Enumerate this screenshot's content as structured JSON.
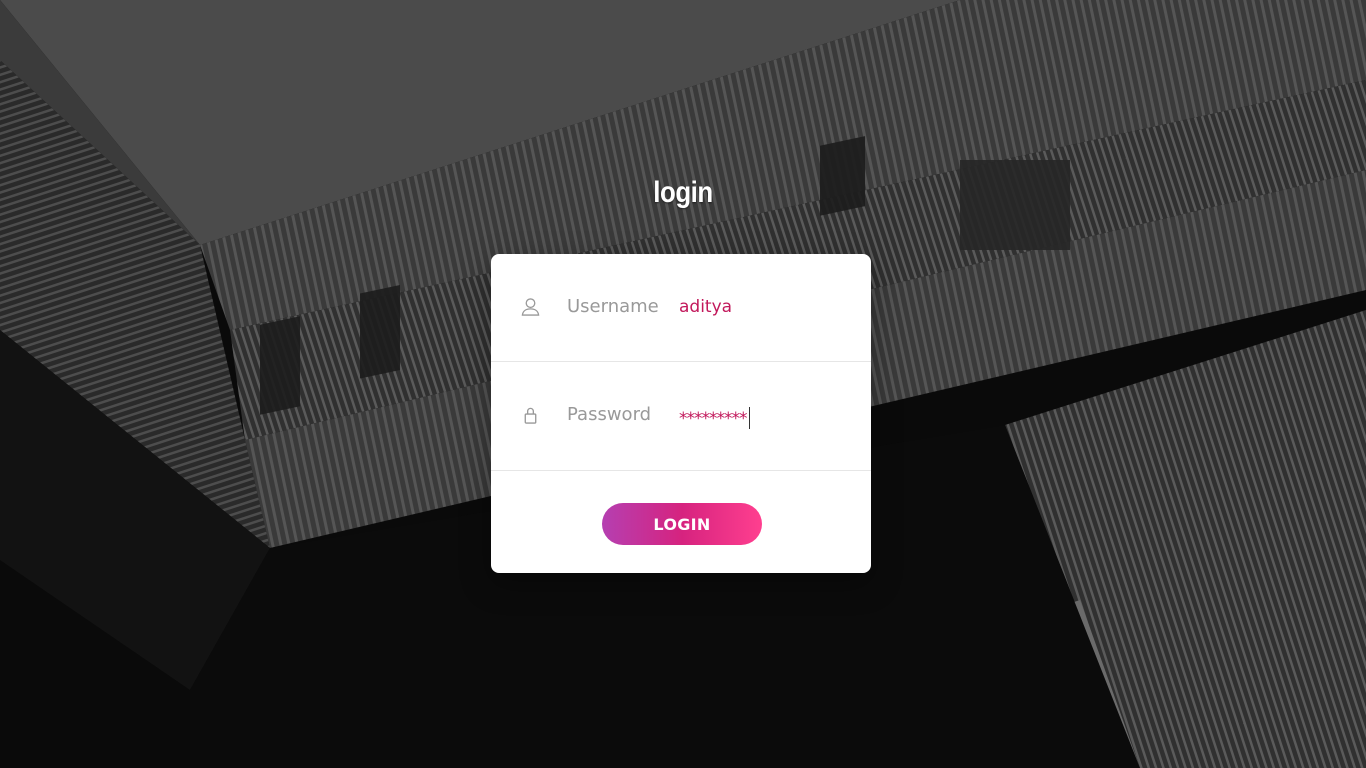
{
  "page": {
    "title": "login"
  },
  "form": {
    "username": {
      "label": "Username",
      "value": "aditya",
      "icon": "user-icon"
    },
    "password": {
      "label": "Password",
      "value": "*********",
      "icon": "lock-icon"
    },
    "submit_label": "LOGIN"
  },
  "colors": {
    "accent": "#c2185b",
    "button_gradient_start": "#b53fb1",
    "button_gradient_end": "#ff3f8f",
    "label": "#999999",
    "card": "#ffffff"
  },
  "background": {
    "description_icon": "building-photo"
  }
}
